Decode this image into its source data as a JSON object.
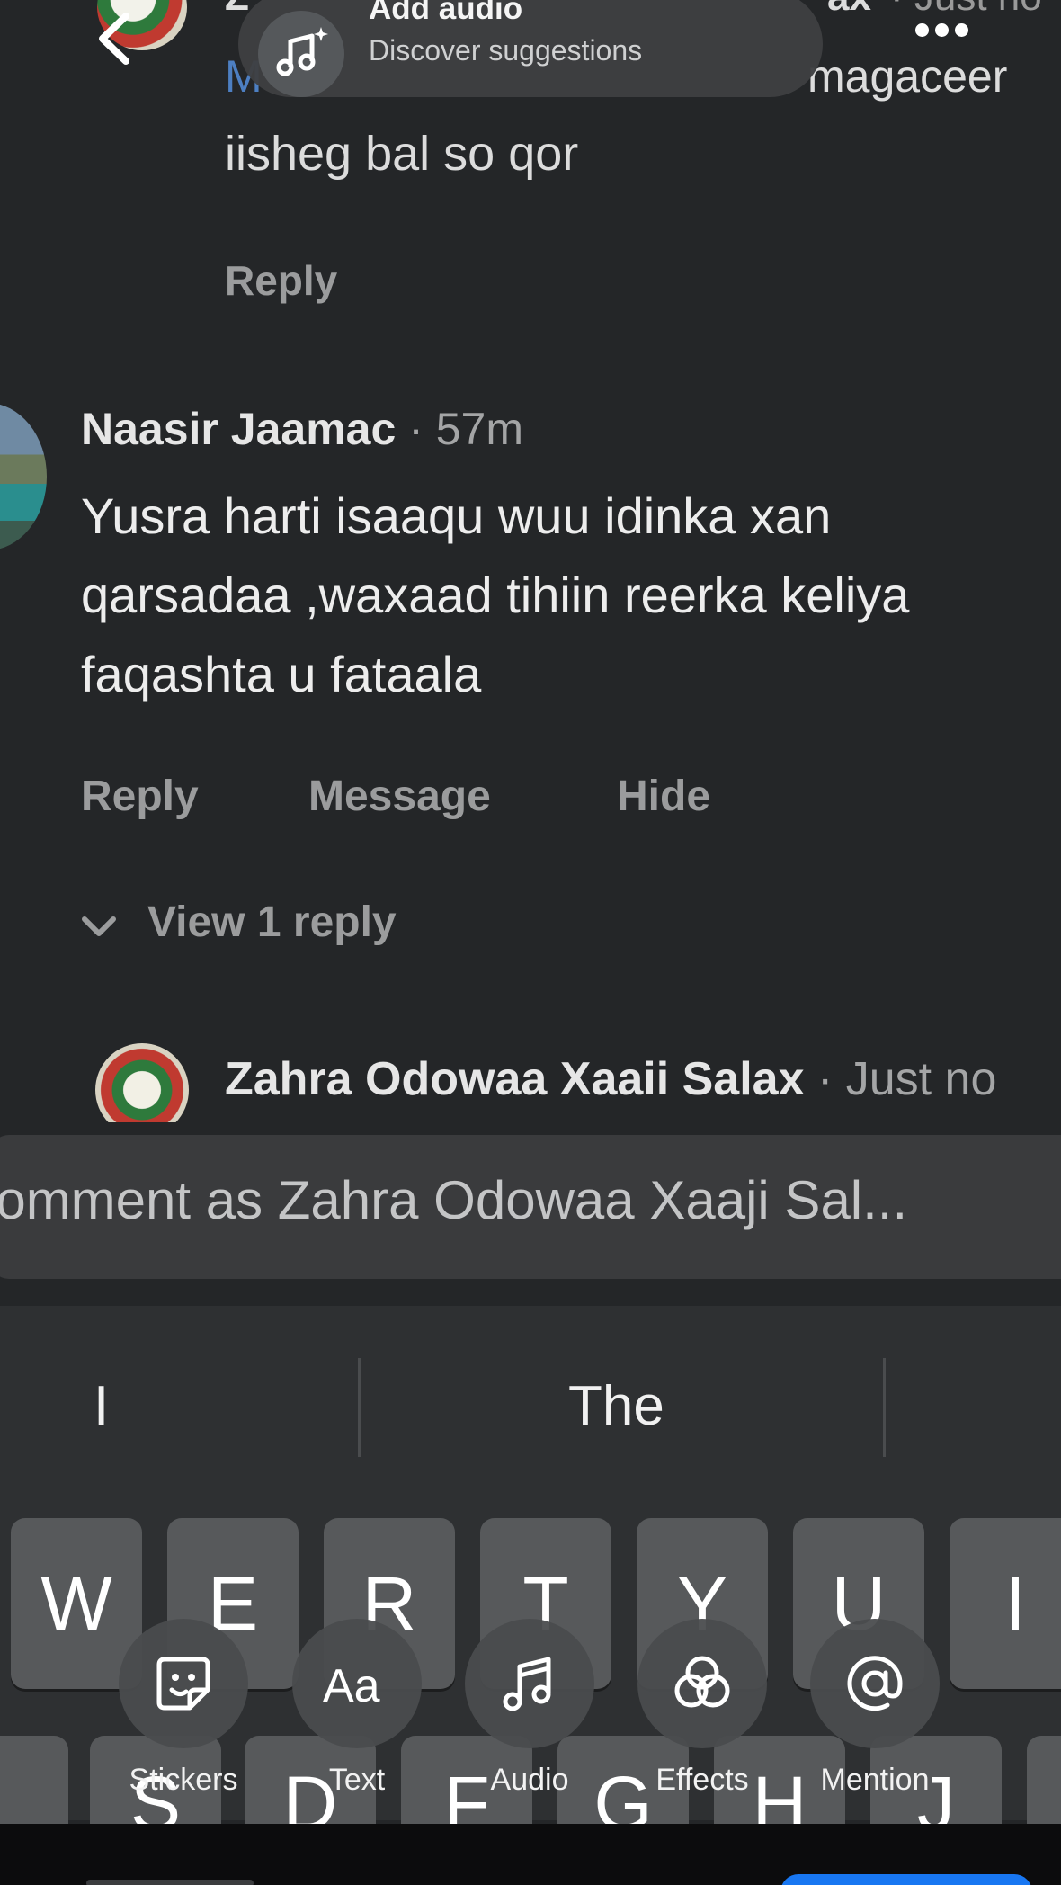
{
  "story_bar": {
    "add_audio_title": "Add audio",
    "add_audio_subtitle": "Discover suggestions",
    "back_icon": "chevron-left-icon",
    "more_icon": "more-dots-icon"
  },
  "comments": [
    {
      "name_left_fragment": "Z",
      "name_right_fragment": "ax",
      "time_fragment": "· Just no",
      "line1_start": "M",
      "line1_end": "magaceer",
      "line2": "iisheg bal so qor",
      "reply_label": "Reply"
    },
    {
      "author": "Naasir Jaamac",
      "time": "· 57m",
      "lines": [
        "Yusra harti isaaqu wuu idinka xan",
        "qarsadaa ,waxaad tihiin reerka keliya",
        "faqashta u fataala"
      ],
      "actions": {
        "reply": "Reply",
        "message": "Message",
        "hide": "Hide"
      },
      "view_replies": "View 1 reply"
    },
    {
      "author": "Zahra Odowaa Xaaii Salax",
      "time": "· Just no"
    }
  ],
  "comment_input": {
    "placeholder": "Comment as Zahra Odowaa Xaaji Sal..."
  },
  "keyboard": {
    "suggestions": [
      "I",
      "The"
    ],
    "row1": [
      "W",
      "E",
      "R",
      "T",
      "Y",
      "U",
      "I"
    ],
    "row2": [
      "",
      "S",
      "D",
      "F",
      "G",
      "H",
      "J",
      ""
    ]
  },
  "tools": [
    {
      "label": "Stickers",
      "icon": "sticker-icon"
    },
    {
      "label": "Text",
      "icon": "text-aa-icon"
    },
    {
      "label": "Audio",
      "icon": "music-note-icon"
    },
    {
      "label": "Effects",
      "icon": "effects-icon"
    },
    {
      "label": "Mention",
      "icon": "at-sign-icon"
    }
  ]
}
